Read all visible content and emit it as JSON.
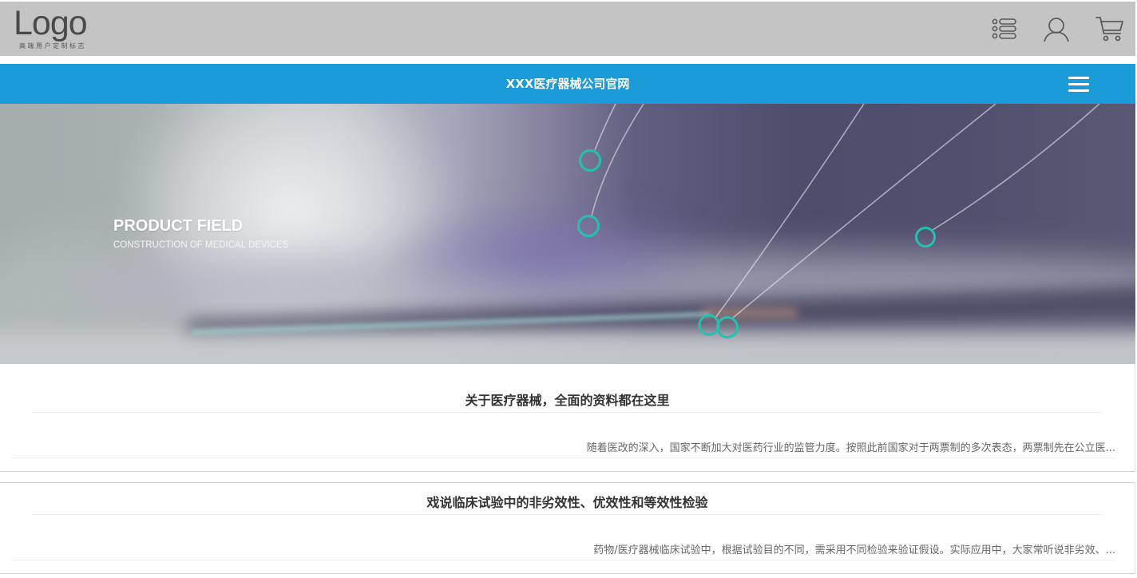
{
  "header": {
    "logo": "Logo",
    "logo_tagline": "高端用户定制标志"
  },
  "nav": {
    "title": "XXX医疗器械公司官网"
  },
  "hero": {
    "title": "PRODUCT FIELD",
    "subtitle": "CONSTRUCTION OF MEDICAL DEVICES"
  },
  "articles": [
    {
      "title": "关于医疗器械，全面的资料都在这里",
      "excerpt": "随着医改的深入，国家不断加大对医药行业的监管力度。按照此前国家对于两票制的多次表态，两票制先在公立医..."
    },
    {
      "title": "戏说临床试验中的非劣效性、优效性和等效性检验",
      "excerpt": "药物/医疗器械临床试验中，根据试验目的不同，需采用不同检验来验证假设。实际应用中，大家常听说非劣效、..."
    }
  ],
  "icons": {
    "menu_list": "list-icon",
    "account": "user-icon",
    "cart": "cart-icon",
    "nav_menu": "hamburger-icon"
  },
  "colors": {
    "header_bg": "#c4c4c4",
    "nav_bg": "#1b9cd8",
    "node_accent": "#23c2ae",
    "icon_stroke": "#5b5b5b",
    "title_text": "#333333",
    "excerpt_text": "#666666"
  }
}
